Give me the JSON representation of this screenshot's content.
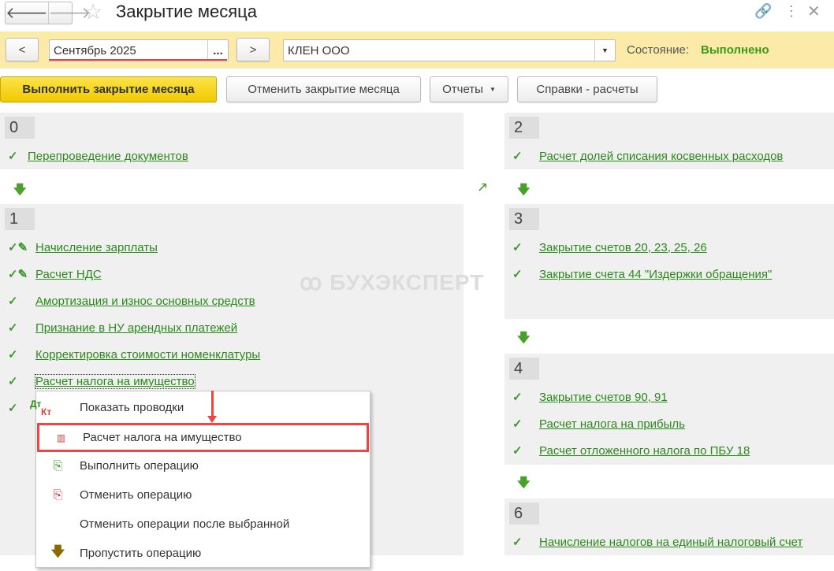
{
  "header": {
    "title": "Закрытие месяца",
    "back": "🡐",
    "forward": "🡒"
  },
  "toolbar": {
    "prev": "<",
    "period": "Сентябрь 2025",
    "period_select": "...",
    "next": ">",
    "organization": "КЛЕН ООО",
    "state_label": "Состояние:",
    "state_value": "Выполнено"
  },
  "actions": {
    "execute": "Выполнить закрытие месяца",
    "cancel": "Отменить закрытие месяца",
    "reports": "Отчеты",
    "references": "Справки - расчеты"
  },
  "watermark": "БУХЭКСПЕРТ",
  "stages": {
    "s0": {
      "num": "0",
      "items": [
        "Перепроведение документов"
      ]
    },
    "s1": {
      "num": "1",
      "items": [
        "Начисление зарплаты",
        "Расчет НДС",
        "Амортизация и износ основных средств",
        "Признание в НУ арендных платежей",
        "Корректировка стоимости номенклатуры",
        "Расчет налога на имущество"
      ]
    },
    "s2": {
      "num": "2",
      "items": [
        "Расчет долей списания косвенных расходов"
      ]
    },
    "s3": {
      "num": "3",
      "items": [
        "Закрытие счетов 20, 23, 25, 26",
        "Закрытие счета 44 \"Издержки обращения\""
      ]
    },
    "s4": {
      "num": "4",
      "items": [
        "Закрытие счетов 90, 91",
        "Расчет налога на прибыль",
        "Расчет отложенного налога по ПБУ 18"
      ]
    },
    "s6": {
      "num": "6",
      "items": [
        "Начисление налогов на единый налоговый счет"
      ]
    }
  },
  "context_menu": {
    "items": [
      "Показать проводки",
      "Расчет налога на имущество",
      "Выполнить операцию",
      "Отменить операцию",
      "Отменить операции после выбранной",
      "Пропустить операцию"
    ],
    "dtkt_dt": "Дт",
    "dtkt_kt": "Кт"
  },
  "colors": {
    "accent": "#f5d800",
    "link": "#2a8a19",
    "highlight": "#f04040"
  }
}
